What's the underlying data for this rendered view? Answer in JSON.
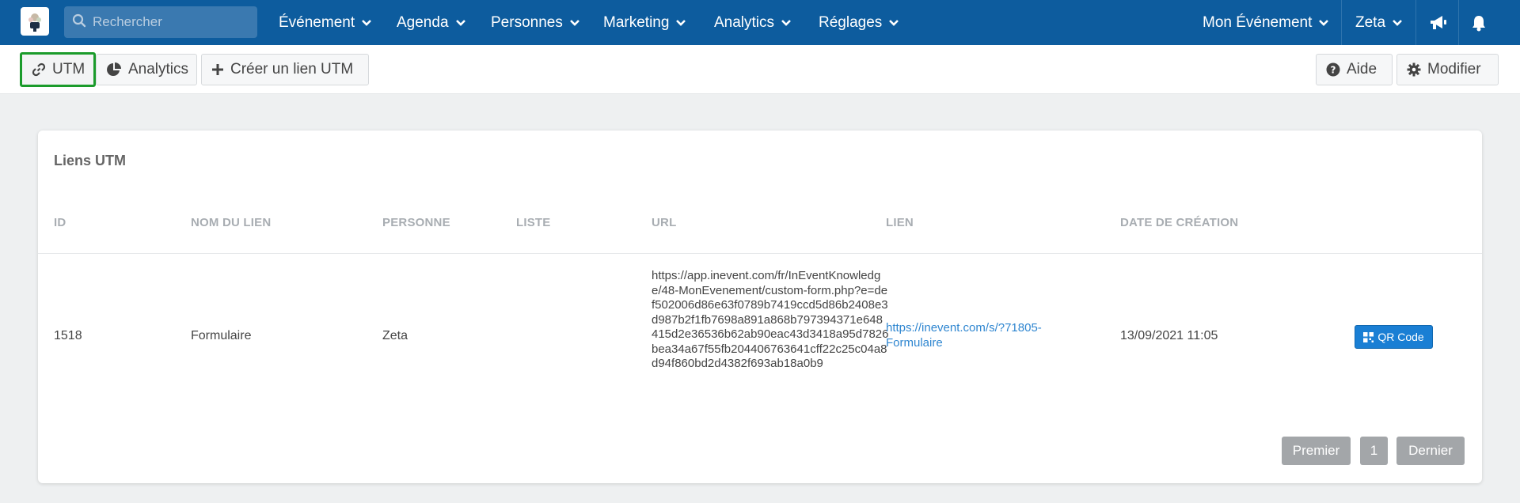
{
  "topbar": {
    "search_placeholder": "Rechercher",
    "nav": [
      {
        "label": "Événement"
      },
      {
        "label": "Agenda"
      },
      {
        "label": "Personnes"
      },
      {
        "label": "Marketing"
      },
      {
        "label": "Analytics"
      },
      {
        "label": "Réglages"
      }
    ],
    "event_selector": "Mon Événement",
    "user": "Zeta",
    "icons": [
      "megaphone-icon",
      "bell-icon"
    ]
  },
  "toolbar": {
    "utm_label": "UTM",
    "analytics_label": "Analytics",
    "create_label": "Créer un lien UTM",
    "help_label": "Aide",
    "edit_label": "Modifier"
  },
  "card": {
    "title": "Liens UTM",
    "columns": [
      "ID",
      "NOM DU LIEN",
      "PERSONNE",
      "LISTE",
      "URL",
      "LIEN",
      "DATE DE CRÉATION"
    ],
    "rows": [
      {
        "id": "1518",
        "name": "Formulaire",
        "person": "Zeta",
        "list": "",
        "url": "https://app.inevent.com/fr/InEventKnowledge/48-MonEvenement/custom-form.php?e=def502006d86e63f0789b7419ccd5d86b2408e3d987b2f1fb7698a891a868b797394371e648415d2e36536b62ab90eac43d3418a95d7826bea34a67f55fb204406763641cff22c25c04a8d94f860bd2d4382f693ab18a0b9",
        "link": "https://inevent.com/s/?71805-Formulaire",
        "created": "13/09/2021 11:05",
        "qr_label": "QR Code"
      }
    ]
  },
  "pagination": {
    "first": "Premier",
    "current": "1",
    "last": "Dernier"
  },
  "colors": {
    "topbar": "#0d5c9e",
    "active_outline": "#1b9b2b",
    "link": "#2f86d0",
    "qr_button": "#1a7fd4"
  }
}
